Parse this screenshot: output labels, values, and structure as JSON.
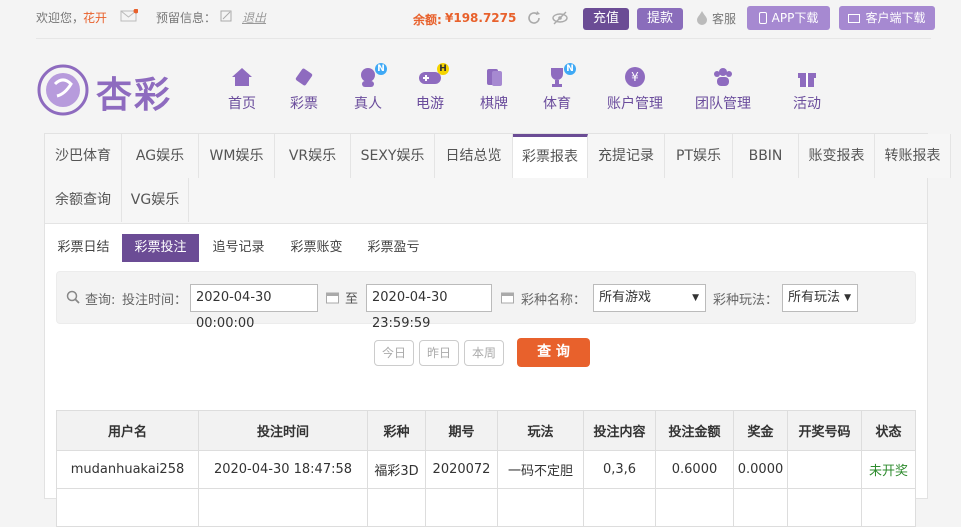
{
  "topbar": {
    "welcome": "欢迎您，",
    "username": "花开",
    "reserve_label": "预留信息：",
    "logout": "退出",
    "balance_label": "余额:",
    "balance_value": "¥198.7275",
    "recharge": "充值",
    "withdraw": "提款",
    "service": "客服",
    "app_download": "APP下载",
    "client_download": "客户端下载"
  },
  "brand": {
    "logo_text": "杏彩"
  },
  "nav": [
    {
      "label": "首页",
      "icon": "home-icon"
    },
    {
      "label": "彩票",
      "icon": "lottery-icon"
    },
    {
      "label": "真人",
      "icon": "live-dealer-icon",
      "badge": "N"
    },
    {
      "label": "电游",
      "icon": "gamepad-icon",
      "badge": "H"
    },
    {
      "label": "棋牌",
      "icon": "cards-icon"
    },
    {
      "label": "体育",
      "icon": "trophy-icon",
      "badge": "N"
    },
    {
      "label": "账户管理",
      "icon": "yen-icon"
    },
    {
      "label": "团队管理",
      "icon": "team-icon"
    },
    {
      "label": "活动",
      "icon": "gift-icon"
    }
  ],
  "tabs_row1": [
    "沙巴体育",
    "AG娱乐",
    "WM娱乐",
    "VR娱乐",
    "SEXY娱乐",
    "日结总览",
    "彩票报表",
    "充提记录",
    "PT娱乐",
    "BBIN",
    "账变报表",
    "转账报表"
  ],
  "tabs_row2": [
    "余额查询",
    "VG娱乐"
  ],
  "active_tab": "彩票报表",
  "subtabs": [
    "彩票日结",
    "彩票投注",
    "追号记录",
    "彩票账变",
    "彩票盈亏"
  ],
  "active_subtab": "彩票投注",
  "filter": {
    "query_label": "查询:",
    "time_label": "投注时间：",
    "start": "2020-04-30 00:00:00",
    "to": "至",
    "end": "2020-04-30 23:59:59",
    "game_label": "彩种名称：",
    "game_value": "所有游戏",
    "play_label": "彩种玩法：",
    "play_value": "所有玩法"
  },
  "quick": {
    "today": "今日",
    "yesterday": "昨日",
    "week": "本周",
    "search": "查 询"
  },
  "table": {
    "headers": [
      "用户名",
      "投注时间",
      "彩种",
      "期号",
      "玩法",
      "投注内容",
      "投注金额",
      "奖金",
      "开奖号码",
      "状态"
    ],
    "rows": [
      [
        "mudanhuakai258",
        "2020-04-30 18:47:58",
        "福彩3D",
        "2020072",
        "一码不定胆",
        "0,3,6",
        "0.6000",
        "0.0000",
        "",
        "未开奖"
      ]
    ]
  },
  "colors": {
    "accent": "#6b4c95",
    "balance": "#e8612c",
    "search": "#e8612c",
    "status_pending": "#2e8b2e"
  }
}
